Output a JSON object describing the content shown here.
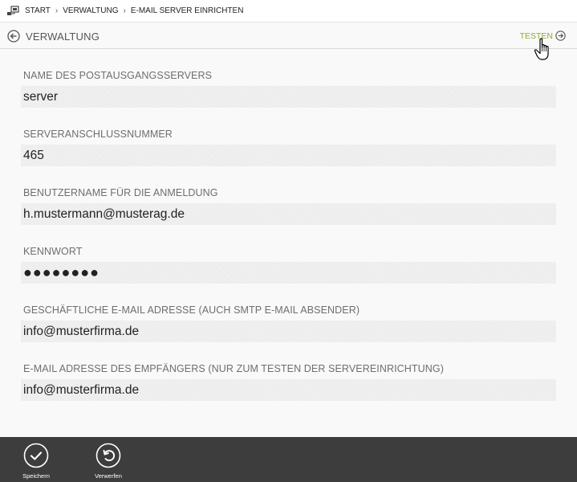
{
  "breadcrumb": {
    "icon": "folder-network-icon",
    "items": [
      "START",
      "VERWALTUNG",
      "E-MAIL SERVER EINRICHTEN"
    ],
    "separator": "›"
  },
  "header": {
    "back_label": "VERWALTUNG",
    "test_label": "TESTEN",
    "accent_color": "#8aac2e"
  },
  "form": {
    "fields": [
      {
        "label": "NAME DES POSTAUSGANGSSERVERS",
        "value": "server"
      },
      {
        "label": "SERVERANSCHLUSSNUMMER",
        "value": "465"
      },
      {
        "label": "BENUTZERNAME FÜR DIE ANMELDUNG",
        "value": "h.mustermann@musterag.de"
      },
      {
        "label": "KENNWORT",
        "value": "●●●●●●●●"
      },
      {
        "label": "GESCHÄFTLICHE E-MAIL ADRESSE (AUCH SMTP E-MAIL ABSENDER)",
        "value": "info@musterfirma.de"
      },
      {
        "label": "E-MAIL ADRESSE DES EMPFÄNGERS (NUR ZUM TESTEN DER SERVEREINRICHTUNG)",
        "value": "info@musterfirma.de"
      }
    ]
  },
  "footer": {
    "save_label": "Speichern",
    "discard_label": "Verwerfen",
    "bg_color": "#3d3d3d"
  }
}
